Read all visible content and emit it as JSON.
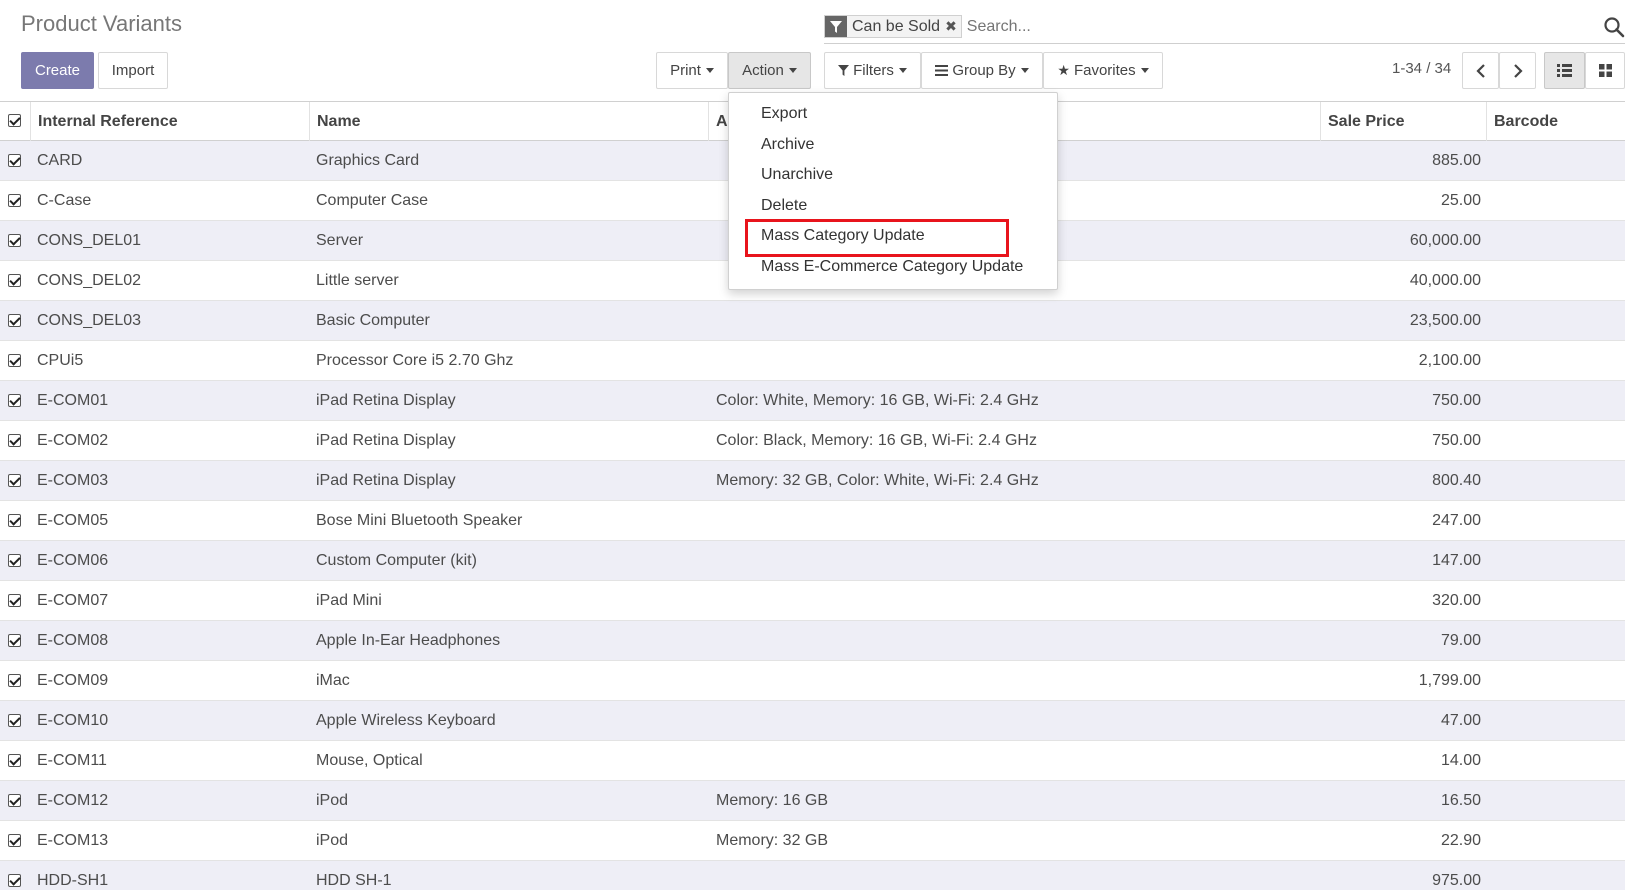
{
  "page": {
    "title": "Product Variants"
  },
  "buttons": {
    "create": "Create",
    "import": "Import",
    "print": "Print",
    "action": "Action"
  },
  "search": {
    "facet_label": "Can be Sold",
    "facet_remove": "✖",
    "placeholder": "Search..."
  },
  "filters": {
    "filters": "Filters",
    "group_by": "Group By",
    "favorites": "Favorites"
  },
  "pager": {
    "value": "1-34 / 34"
  },
  "columns": {
    "internal_reference": "Internal Reference",
    "name": "Name",
    "attributes": "A",
    "sale_price": "Sale Price",
    "barcode": "Barcode"
  },
  "rows": [
    {
      "ref": "CARD",
      "name": "Graphics Card",
      "attrs": "",
      "price": "885.00"
    },
    {
      "ref": "C-Case",
      "name": "Computer Case",
      "attrs": "",
      "price": "25.00"
    },
    {
      "ref": "CONS_DEL01",
      "name": "Server",
      "attrs": "",
      "price": "60,000.00"
    },
    {
      "ref": "CONS_DEL02",
      "name": "Little server",
      "attrs": "",
      "price": "40,000.00"
    },
    {
      "ref": "CONS_DEL03",
      "name": "Basic Computer",
      "attrs": "",
      "price": "23,500.00"
    },
    {
      "ref": "CPUi5",
      "name": "Processor Core i5 2.70 Ghz",
      "attrs": "",
      "price": "2,100.00"
    },
    {
      "ref": "E-COM01",
      "name": "iPad Retina Display",
      "attrs": "Color: White, Memory: 16 GB, Wi-Fi: 2.4 GHz",
      "price": "750.00"
    },
    {
      "ref": "E-COM02",
      "name": "iPad Retina Display",
      "attrs": "Color: Black, Memory: 16 GB, Wi-Fi: 2.4 GHz",
      "price": "750.00"
    },
    {
      "ref": "E-COM03",
      "name": "iPad Retina Display",
      "attrs": "Memory: 32 GB, Color: White, Wi-Fi: 2.4 GHz",
      "price": "800.40"
    },
    {
      "ref": "E-COM05",
      "name": "Bose Mini Bluetooth Speaker",
      "attrs": "",
      "price": "247.00"
    },
    {
      "ref": "E-COM06",
      "name": "Custom Computer (kit)",
      "attrs": "",
      "price": "147.00"
    },
    {
      "ref": "E-COM07",
      "name": "iPad Mini",
      "attrs": "",
      "price": "320.00"
    },
    {
      "ref": "E-COM08",
      "name": "Apple In-Ear Headphones",
      "attrs": "",
      "price": "79.00"
    },
    {
      "ref": "E-COM09",
      "name": "iMac",
      "attrs": "",
      "price": "1,799.00"
    },
    {
      "ref": "E-COM10",
      "name": "Apple Wireless Keyboard",
      "attrs": "",
      "price": "47.00"
    },
    {
      "ref": "E-COM11",
      "name": "Mouse, Optical",
      "attrs": "",
      "price": "14.00"
    },
    {
      "ref": "E-COM12",
      "name": "iPod",
      "attrs": "Memory: 16 GB",
      "price": "16.50"
    },
    {
      "ref": "E-COM13",
      "name": "iPod",
      "attrs": "Memory: 32 GB",
      "price": "22.90"
    },
    {
      "ref": "HDD-SH1",
      "name": "HDD SH-1",
      "attrs": "",
      "price": "975.00"
    }
  ],
  "action_menu": [
    "Export",
    "Archive",
    "Unarchive",
    "Delete",
    "Mass Category Update",
    "Mass E-Commerce Category Update"
  ],
  "colors": {
    "primary": "#7c7bad",
    "highlight": "#e8141c",
    "row_alt": "#eeeef6"
  }
}
